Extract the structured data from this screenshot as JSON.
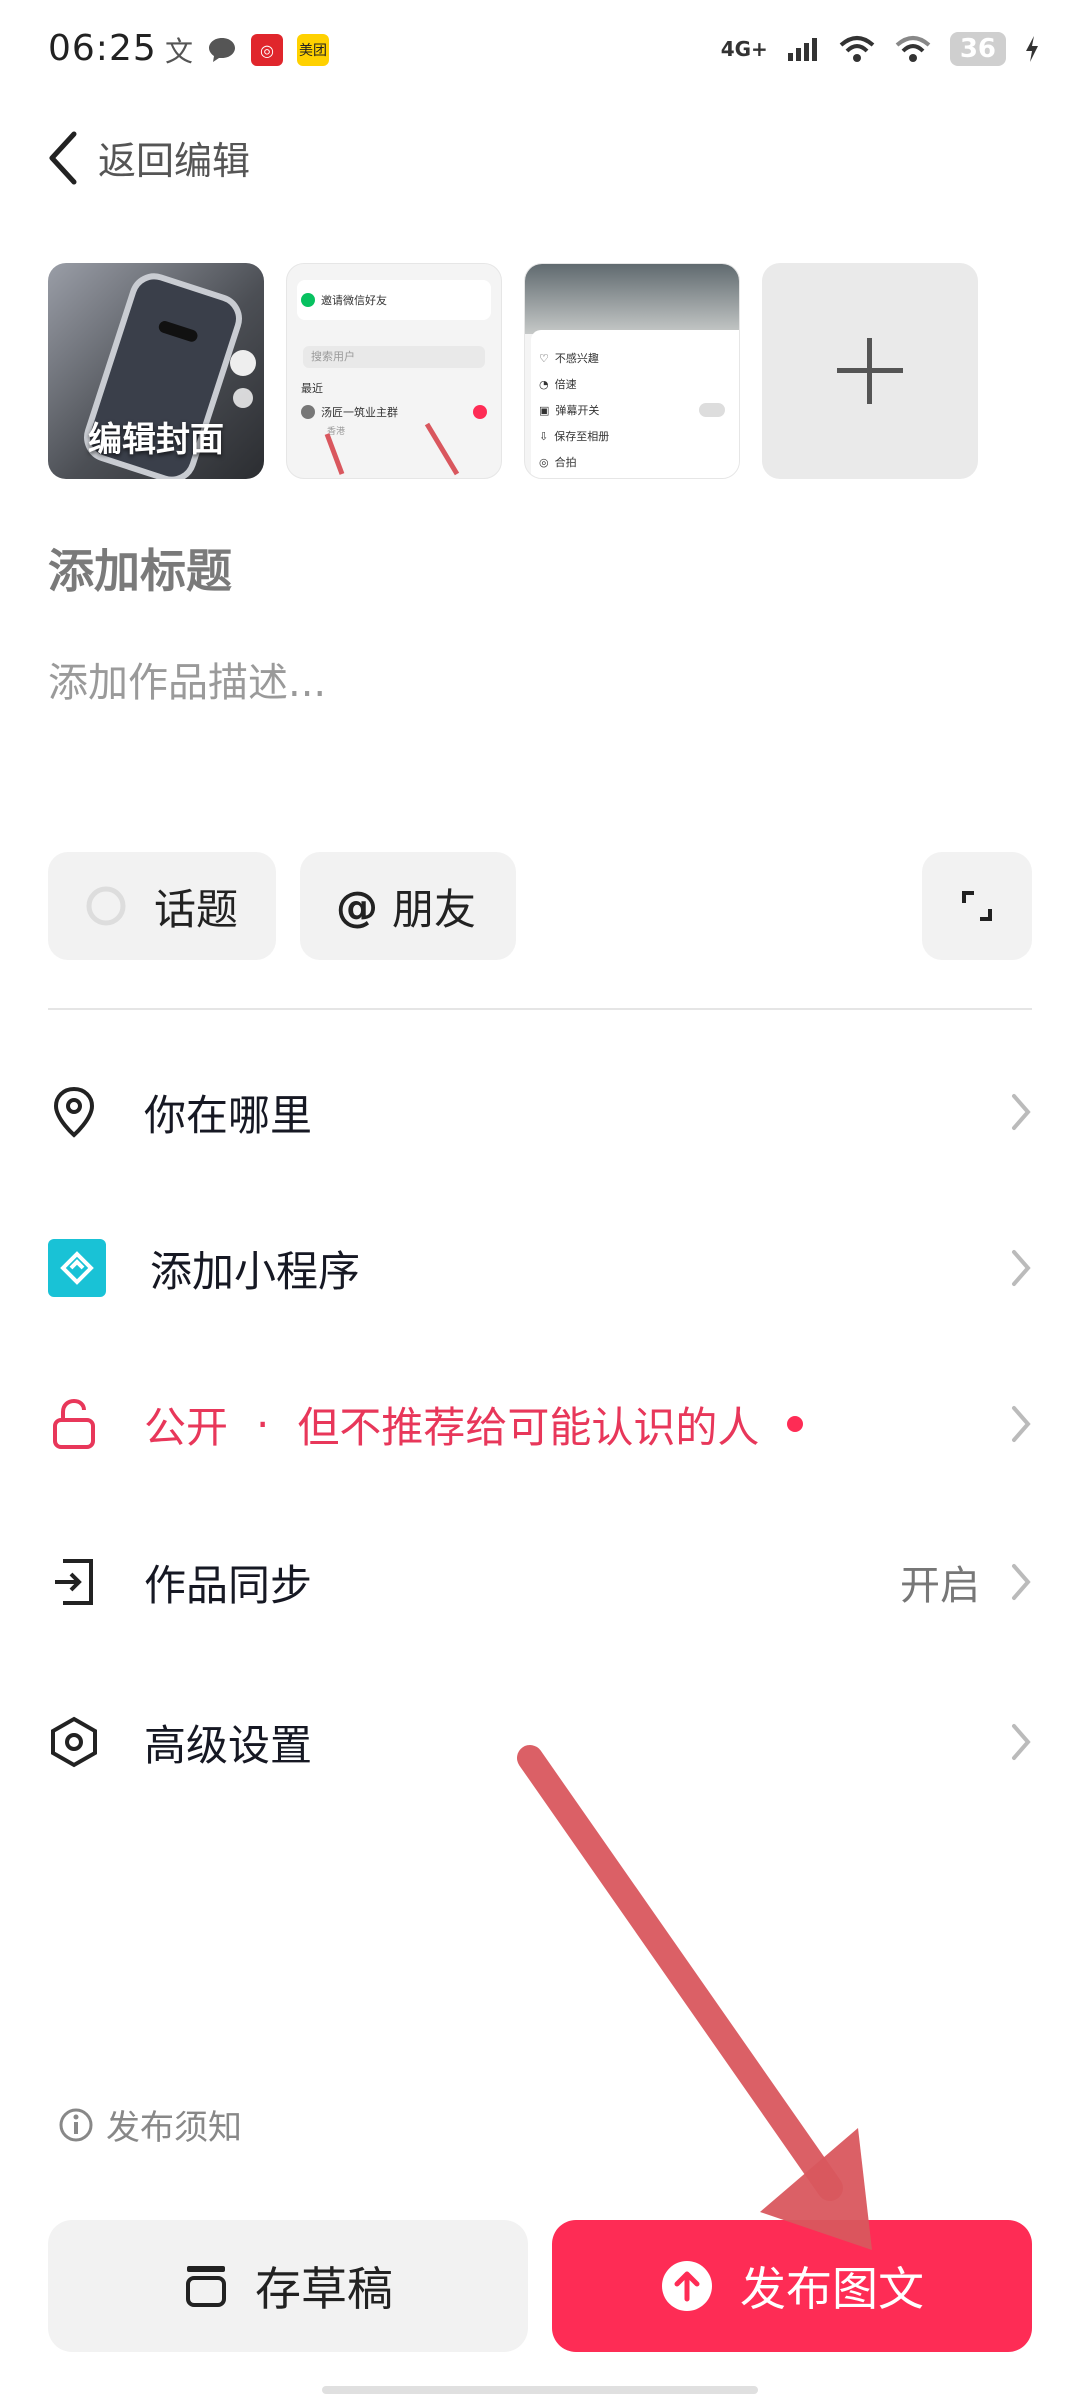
{
  "status_bar": {
    "time": "06:25",
    "notif_icons": [
      "translate-icon",
      "chat-bubble-icon",
      "netease-music-icon",
      "meituan-icon"
    ],
    "meituan_label": "美团",
    "network": "4G+",
    "battery": "36"
  },
  "header": {
    "back_label": "返回编辑"
  },
  "media": {
    "cover_label": "编辑封面",
    "thumb2": {
      "row1": "邀请微信好友",
      "search": "搜索用户",
      "section": "最近",
      "contact": "汤匠一筑业主群",
      "sub": "香港"
    },
    "thumb3": {
      "row1": "不感兴趣",
      "row2": "倍速",
      "row3": "弹幕开关",
      "row4": "保存至相册",
      "row5": "合拍"
    }
  },
  "compose": {
    "title_placeholder": "添加标题",
    "desc_placeholder": "添加作品描述..."
  },
  "chips": {
    "topic": "话题",
    "friends_symbol": "@",
    "friends": "朋友"
  },
  "menu": {
    "location": "你在哪里",
    "mini_program": "添加小程序",
    "visibility_main": "公开",
    "visibility_sep": "·",
    "visibility_sub": "但不推荐给可能认识的人",
    "sync": "作品同步",
    "sync_value": "开启",
    "advanced": "高级设置"
  },
  "footer": {
    "notice": "发布须知",
    "draft": "存草稿",
    "publish": "发布图文"
  },
  "colors": {
    "accent": "#fe2c55",
    "teal": "#19c2d6"
  }
}
